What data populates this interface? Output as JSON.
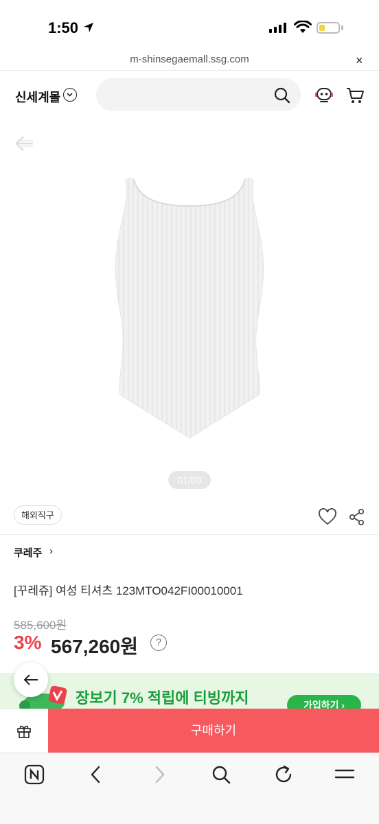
{
  "status_bar": {
    "time": "1:50"
  },
  "browser": {
    "url": "m-shinsegaemall.ssg.com",
    "close_label": "×"
  },
  "header": {
    "logo": "신세계몰"
  },
  "gallery": {
    "page_indicator": "01/03"
  },
  "product": {
    "badge": "해외직구",
    "brand": "쿠레주",
    "brand_chevron": "›",
    "title": "[꾸레쥬] 여성 티셔츠 123MTO042FI00010001",
    "original_price": "585,600원",
    "discount_rate": "3%",
    "sale_price": "567,260원",
    "help": "?"
  },
  "promo": {
    "text": "장보기 7% 적립에 티빙까지",
    "cta": "가입하기 ›"
  },
  "purchase": {
    "buy_label": "구매하기"
  },
  "colors": {
    "accent_red": "#f65a5f",
    "discount_red": "#e9424b",
    "promo_green": "#2ab54b"
  }
}
